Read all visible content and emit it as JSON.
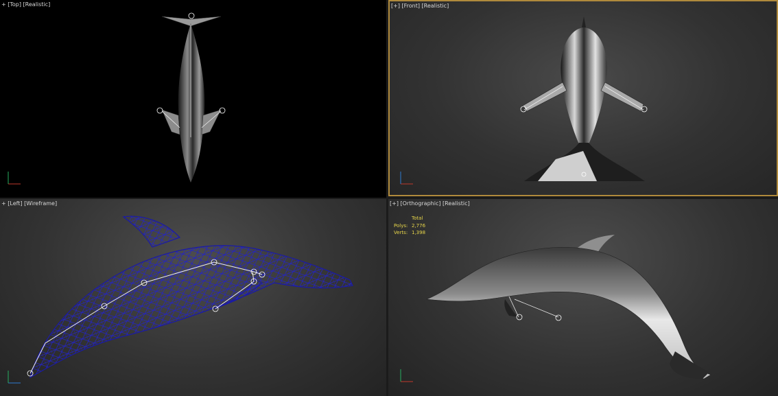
{
  "viewports": {
    "top": {
      "plus": "+",
      "view": "Top",
      "shading": "Realistic"
    },
    "front": {
      "plus": "+",
      "view": "Front",
      "shading": "Realistic"
    },
    "left": {
      "plus": "+",
      "view": "Left",
      "shading": "Wireframe"
    },
    "ortho": {
      "plus": "+",
      "view": "Orthographic",
      "shading": "Realistic"
    }
  },
  "stats": {
    "total_label": "Total",
    "polys_label": "Polys:",
    "polys_value": "2,776",
    "verts_label": "Verts:",
    "verts_value": "1,398"
  },
  "colors": {
    "active_border": "#b08a3c",
    "wire": "#1a1aa8",
    "stats": "#e8d64a"
  },
  "icons": [
    "axis-gizmo-icon",
    "bone-node-icon"
  ]
}
